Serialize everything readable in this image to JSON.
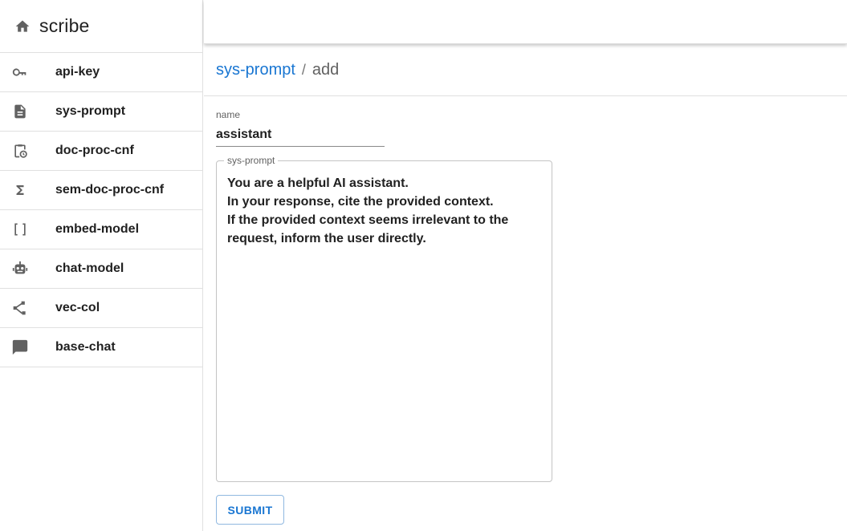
{
  "sidebar": {
    "brand": {
      "title": "scribe",
      "icon": "home-icon"
    },
    "items": [
      {
        "label": "api-key",
        "icon": "key-icon"
      },
      {
        "label": "sys-prompt",
        "icon": "document-icon"
      },
      {
        "label": "doc-proc-cnf",
        "icon": "clipboard-clock-icon"
      },
      {
        "label": "sem-doc-proc-cnf",
        "icon": "sigma-icon"
      },
      {
        "label": "embed-model",
        "icon": "brackets-icon"
      },
      {
        "label": "chat-model",
        "icon": "robot-icon"
      },
      {
        "label": "vec-col",
        "icon": "share-icon"
      },
      {
        "label": "base-chat",
        "icon": "chat-icon"
      }
    ]
  },
  "breadcrumb": {
    "link": "sys-prompt",
    "separator": "/",
    "current": "add"
  },
  "form": {
    "name_label": "name",
    "name_value": "assistant",
    "prompt_label": "sys-prompt",
    "prompt_lines": [
      "You are a helpful AI assistant.",
      "In your response, cite the provided context.",
      "If the provided context seems irrelevant to the",
      "request, inform the user directly."
    ],
    "submit_label": "SUBMIT"
  },
  "colors": {
    "accent": "#1976d2",
    "icon": "#616161",
    "text": "#212121",
    "divider": "#e0e0e0"
  }
}
